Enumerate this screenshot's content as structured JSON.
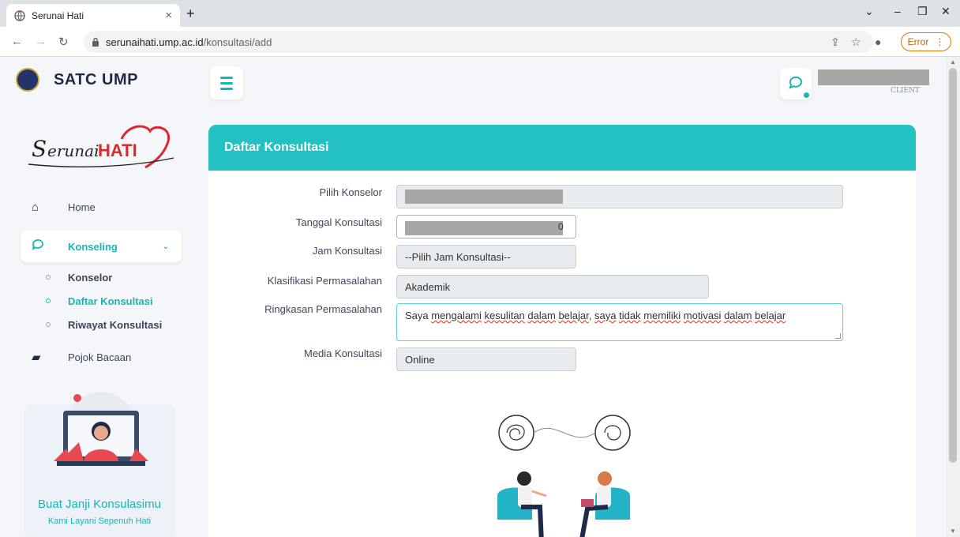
{
  "browser": {
    "tab_title": "Serunai Hati",
    "url_host": "serunaihati.ump.ac.id",
    "url_path": "/konsultasi/add",
    "error_label": "Error"
  },
  "app": {
    "brand": "SATC UMP",
    "logo_text": "SerunaiHATI",
    "user_role": "CLIENT"
  },
  "sidebar": {
    "items": [
      {
        "label": "Home",
        "icon": "home-icon"
      },
      {
        "label": "Konseling",
        "icon": "chat-icon"
      },
      {
        "label": "Pojok Bacaan",
        "icon": "book-icon"
      }
    ],
    "sub_items": [
      {
        "label": "Konselor"
      },
      {
        "label": "Daftar Konsultasi"
      },
      {
        "label": "Riwayat Konsultasi"
      }
    ],
    "promo_title": "Buat Janji Konsulasimu",
    "promo_subtitle": "Kami Layani Sepenuh Hati"
  },
  "card": {
    "title": "Daftar Konsultasi"
  },
  "form": {
    "konselor_label": "Pilih Konselor",
    "tanggal_label": "Tanggal Konsultasi",
    "tanggal_value_tail": "0",
    "jam_label": "Jam Konsultasi",
    "jam_value": "--Pilih Jam Konsultasi--",
    "klasifikasi_label": "Klasifikasi Permasalahan",
    "klasifikasi_value": "Akademik",
    "ringkasan_label": "Ringkasan Permasalahan",
    "ringkasan_value": [
      "Saya ",
      "mengalami",
      " ",
      "kesulitan",
      " ",
      "dalam",
      " ",
      "belajar",
      ", ",
      "saya",
      " ",
      "tidak",
      " ",
      "memiliki",
      " ",
      "motivasi",
      " ",
      "dalam",
      " ",
      "belajar"
    ],
    "media_label": "Media Konsultasi",
    "media_value": "Online"
  },
  "colors": {
    "accent": "#24c1c3",
    "accent_text": "#1ab5b5",
    "navy": "#1f2a4a"
  }
}
